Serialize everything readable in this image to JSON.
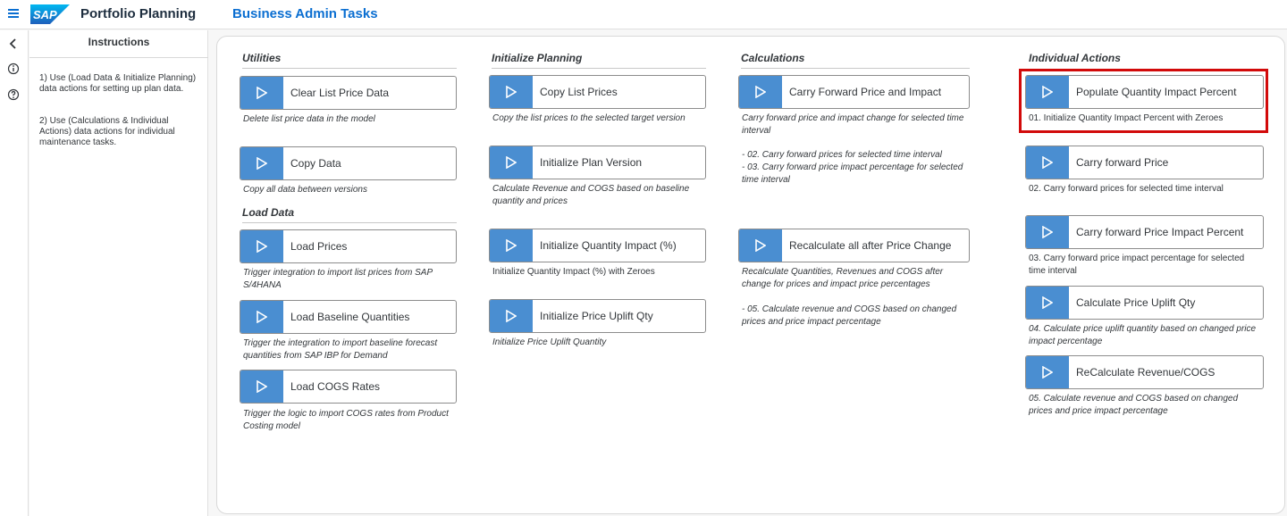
{
  "header": {
    "app_title": "Portfolio Planning",
    "page_title": "Business Admin Tasks",
    "logo_text": "SAP"
  },
  "instructions": {
    "title": "Instructions",
    "paragraphs": [
      "1) Use (Load Data & Initialize Planning) data actions for setting up plan data.",
      "2) Use (Calculations & Individual Actions) data actions for individual maintenance tasks."
    ]
  },
  "sections": {
    "utilities": {
      "title": "Utilities",
      "actions": [
        {
          "label": "Clear List Price Data",
          "desc": "Delete list price data in the model"
        },
        {
          "label": "Copy Data",
          "desc": "Copy all data between versions"
        }
      ]
    },
    "load_data": {
      "title": "Load Data",
      "actions": [
        {
          "label": "Load Prices",
          "desc": "Trigger integration to import list prices from SAP S/4HANA"
        },
        {
          "label": "Load Baseline Quantities",
          "desc": "Trigger the integration to import baseline forecast quantities from SAP IBP for Demand"
        },
        {
          "label": "Load COGS Rates",
          "desc": "Trigger the logic to import COGS rates from Product Costing model"
        }
      ]
    },
    "initialize_planning": {
      "title": "Initialize Planning",
      "actions": [
        {
          "label": "Copy List Prices",
          "desc": "Copy the list prices to the selected target version"
        },
        {
          "label": "Initialize Plan Version",
          "desc": "Calculate Revenue and COGS based on baseline quantity and prices"
        },
        {
          "label": "Initialize Quantity Impact (%)",
          "desc": "Initialize Quantity Impact (%) with Zeroes"
        },
        {
          "label": "Initialize Price Uplift Qty",
          "desc": "Initialize Price Uplift Quantity"
        }
      ]
    },
    "calculations": {
      "title": "Calculations",
      "actions": [
        {
          "label": "Carry Forward Price and Impact",
          "desc": "Carry forward price and impact change for selected time interval",
          "desc2": "- 02. Carry forward prices for selected time interval",
          "desc3": "- 03. Carry forward price impact percentage for selected time interval"
        },
        {
          "label": "Recalculate all after Price Change",
          "desc": "Recalculate Quantities, Revenues and COGS after change for prices and impact price percentages",
          "desc2": "- 05. Calculate revenue and COGS based on changed prices and price impact percentage"
        }
      ]
    },
    "individual_actions": {
      "title": "Individual Actions",
      "actions": [
        {
          "label": "Populate Quantity Impact Percent",
          "desc": "01. Initialize Quantity Impact Percent with Zeroes"
        },
        {
          "label": "Carry forward Price",
          "desc": "02. Carry forward prices for selected time interval"
        },
        {
          "label": "Carry forward Price Impact Percent",
          "desc": "03. Carry forward price impact percentage for selected time interval"
        },
        {
          "label": "Calculate Price Uplift Qty",
          "desc": "04. Calculate price uplift quantity based on changed price impact percentage"
        },
        {
          "label": "ReCalculate Revenue/COGS",
          "desc": "05. Calculate revenue and COGS based on changed prices and price impact percentage"
        }
      ]
    }
  },
  "colors": {
    "accent": "#0a6ed1",
    "play_button": "#4a8ed1",
    "highlight": "#d20a0a"
  },
  "icons": [
    "menu-icon",
    "back-icon",
    "info-icon",
    "help-icon",
    "play-icon"
  ]
}
